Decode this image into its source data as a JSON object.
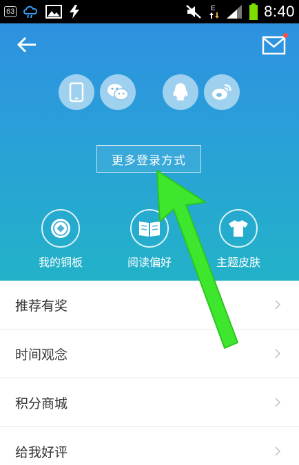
{
  "status_bar": {
    "notification_count": "63",
    "time": "8:40",
    "icons": [
      "cloud-rain-icon",
      "image-icon",
      "usb-bolt-icon",
      "mute-icon",
      "edge-data-icon",
      "signal-icon",
      "battery-icon"
    ],
    "network_type": "E"
  },
  "header": {
    "back_icon": "back-arrow-icon",
    "mail_icon": "mail-icon",
    "login_methods": [
      "phone-icon",
      "wechat-icon",
      "qq-icon",
      "weibo-icon"
    ],
    "more_login_label": "更多登录方式",
    "features": [
      {
        "label": "我的铜板",
        "icon": "coin-icon"
      },
      {
        "label": "阅读偏好",
        "icon": "book-icon"
      },
      {
        "label": "主题皮肤",
        "icon": "tshirt-icon"
      }
    ],
    "colors": {
      "gradient_top": "#2e91e0",
      "gradient_bottom": "#22b2c8",
      "mail_badge": "#ff4a4a"
    }
  },
  "menu": {
    "items": [
      {
        "label": "推荐有奖"
      },
      {
        "label": "时间观念"
      },
      {
        "label": "积分商城"
      },
      {
        "label": "给我好评"
      }
    ]
  },
  "annotation": {
    "arrow_color": "#3ee62d"
  }
}
